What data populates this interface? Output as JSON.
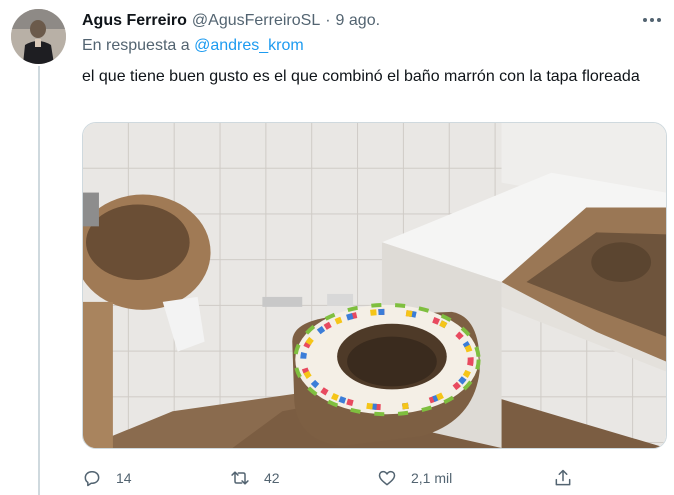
{
  "tweet": {
    "author_name": "Agus Ferreiro",
    "author_handle": "@AgusFerreiroSL",
    "separator": "·",
    "date": "9 ago.",
    "reply_prefix": "En respuesta a",
    "reply_mention": "@andres_krom",
    "text": "el que tiene buen gusto es el que combinó el baño marrón con la tapa floreada",
    "image_alt": "bathroom-photo"
  },
  "actions": {
    "reply_count": "14",
    "retweet_count": "42",
    "like_count": "2,1 mil"
  },
  "icons": {
    "more": "more-dots-icon",
    "reply": "reply-bubble-icon",
    "retweet": "retweet-icon",
    "like": "heart-icon",
    "share": "share-icon"
  },
  "colors": {
    "text": "#0f1419",
    "muted": "#536471",
    "link": "#1d9bf0",
    "divider": "#cfd9de"
  }
}
